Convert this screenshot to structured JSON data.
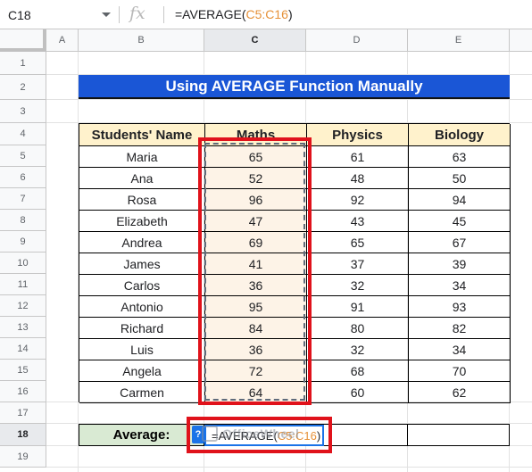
{
  "formula_bar": {
    "name_box": "C18",
    "fx_label": "fx",
    "formula_prefix": "=AVERAGE(",
    "formula_ref": "C5:C16",
    "formula_suffix": ")"
  },
  "columns": [
    "A",
    "B",
    "C",
    "D",
    "E"
  ],
  "rows": [
    "1",
    "2",
    "3",
    "4",
    "5",
    "6",
    "7",
    "8",
    "9",
    "10",
    "11",
    "12",
    "13",
    "14",
    "15",
    "16",
    "17",
    "18",
    "19"
  ],
  "title": "Using AVERAGE Function Manually",
  "table": {
    "headers": [
      "Students' Name",
      "Maths",
      "Physics",
      "Biology"
    ],
    "rows": [
      [
        "Maria",
        "65",
        "61",
        "63"
      ],
      [
        "Ana",
        "52",
        "48",
        "50"
      ],
      [
        "Rosa",
        "96",
        "92",
        "94"
      ],
      [
        "Elizabeth",
        "47",
        "43",
        "45"
      ],
      [
        "Andrea",
        "69",
        "65",
        "67"
      ],
      [
        "James",
        "41",
        "37",
        "39"
      ],
      [
        "Carlos",
        "36",
        "32",
        "34"
      ],
      [
        "Antonio",
        "95",
        "91",
        "93"
      ],
      [
        "Richard",
        "84",
        "80",
        "82"
      ],
      [
        "Luis",
        "36",
        "32",
        "34"
      ],
      [
        "Angela",
        "72",
        "68",
        "70"
      ],
      [
        "Carmen",
        "64",
        "60",
        "62"
      ]
    ]
  },
  "average": {
    "label": "Average:",
    "edit_prefix": "=AVERAGE(",
    "edit_ref": "C5:C16",
    "edit_suffix": ")",
    "help_badge": "?"
  },
  "watermark": "OfficeWheel",
  "colors": {
    "title_bg": "#1a56d6",
    "header_bg": "#fff2cc",
    "maths_bg": "#fdf3e7",
    "average_label_bg": "#d9ead3",
    "highlight_red": "#e0121b",
    "range_ref": "#e69138"
  }
}
